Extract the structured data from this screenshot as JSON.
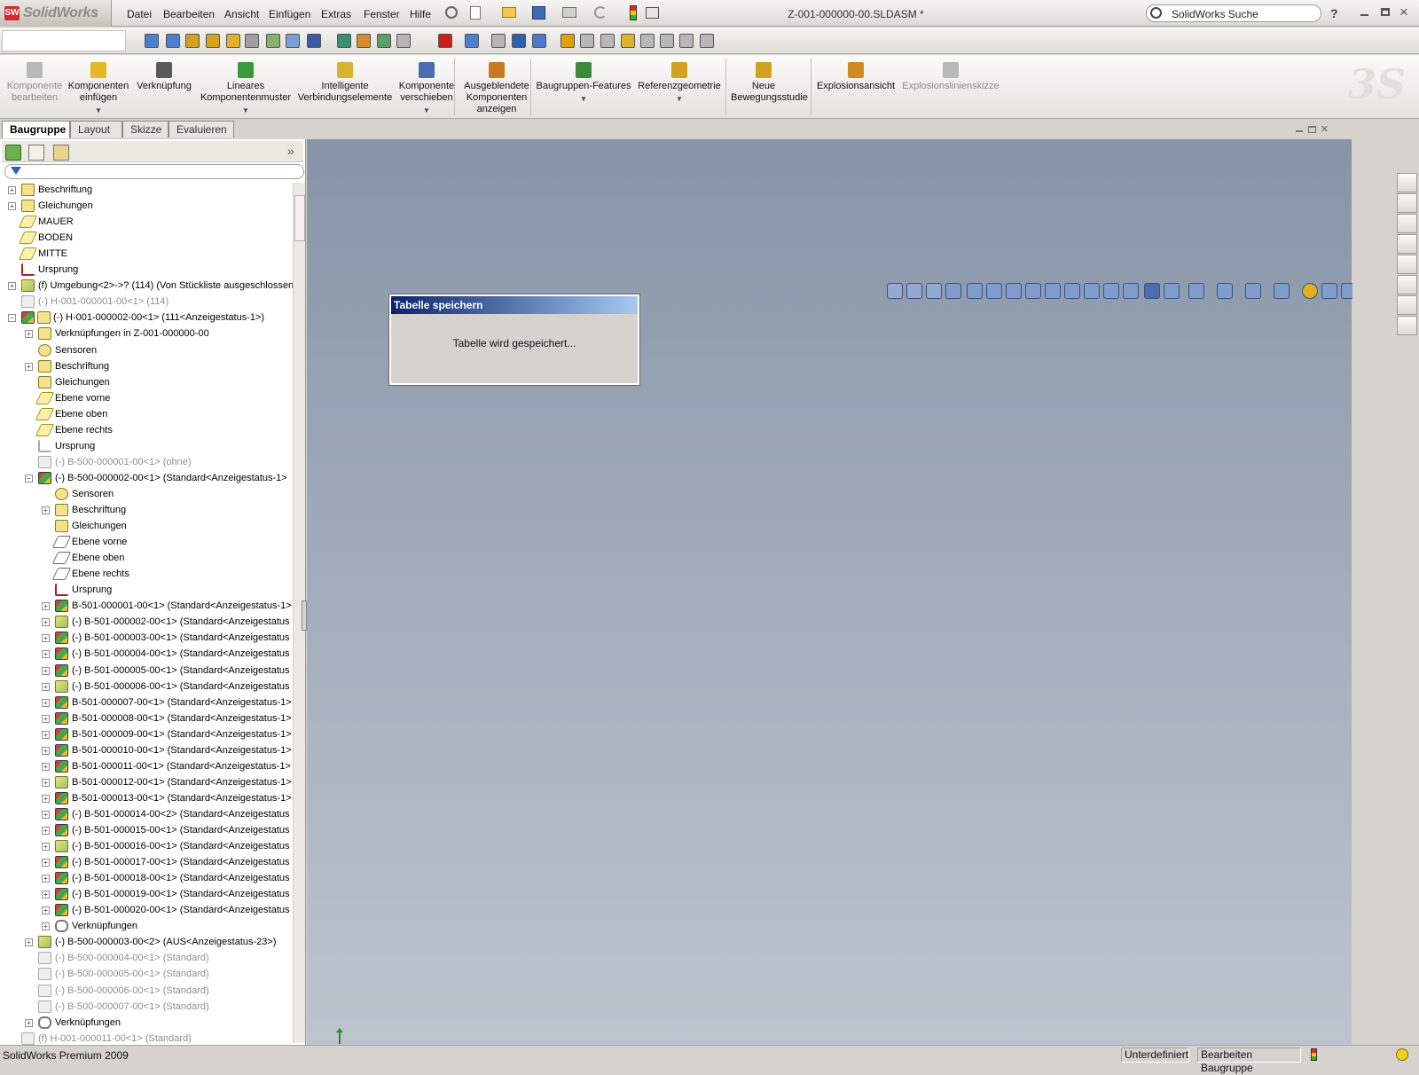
{
  "app": {
    "name": "SolidWorks",
    "logo": "SW",
    "document_title": "Z-001-000000-00.SLDASM *"
  },
  "menu": [
    "Datei",
    "Bearbeiten",
    "Ansicht",
    "Einfügen",
    "Extras",
    "Fenster",
    "Hilfe"
  ],
  "search": {
    "label": "SolidWorks Suche",
    "help": "?"
  },
  "command_manager": [
    {
      "label": "Komponente\nbearbeiten",
      "disabled": true,
      "icon": "edit-component-icon"
    },
    {
      "label": "Komponenten\neinfügen",
      "disabled": false,
      "icon": "insert-components-icon",
      "dropdown": true
    },
    {
      "label": "Verknüpfung",
      "disabled": false,
      "icon": "mate-icon"
    },
    {
      "label": "Lineares\nKomponentenmuster",
      "disabled": false,
      "icon": "linear-pattern-icon",
      "dropdown": true
    },
    {
      "label": "Intelligente\nVerbindungselemente",
      "disabled": false,
      "icon": "smart-fasteners-icon"
    },
    {
      "label": "Komponente\nverschieben",
      "disabled": false,
      "icon": "move-component-icon",
      "dropdown": true
    },
    {
      "label": "Ausgeblendete\nKomponenten\nanzeigen",
      "disabled": false,
      "icon": "show-hidden-icon"
    },
    {
      "label": "Baugruppen-Features",
      "disabled": false,
      "icon": "assembly-features-icon",
      "dropdown": true
    },
    {
      "label": "Referenzgeometrie",
      "disabled": false,
      "icon": "reference-geometry-icon",
      "dropdown": true
    },
    {
      "label": "Neue\nBewegungsstudie",
      "disabled": false,
      "icon": "motion-study-icon"
    },
    {
      "label": "Explosionsansicht",
      "disabled": false,
      "icon": "exploded-view-icon"
    },
    {
      "label": "Explosionslinienskizze",
      "disabled": true,
      "icon": "explode-line-sketch-icon"
    }
  ],
  "tabs": [
    "Baugruppe",
    "Layout",
    "Skizze",
    "Evaluieren"
  ],
  "tree": [
    {
      "label": "Beschriftung",
      "indent": 0,
      "exp": "+",
      "icon": "annotation",
      "dim": false
    },
    {
      "label": "Gleichungen",
      "indent": 0,
      "exp": "+",
      "icon": "equation",
      "dim": false
    },
    {
      "label": "MAUER",
      "indent": 0,
      "exp": "",
      "icon": "plane",
      "dim": false
    },
    {
      "label": "BODEN",
      "indent": 0,
      "exp": "",
      "icon": "plane",
      "dim": false
    },
    {
      "label": "MITTE",
      "indent": 0,
      "exp": "",
      "icon": "plane",
      "dim": false
    },
    {
      "label": "Ursprung",
      "indent": 0,
      "exp": "",
      "icon": "origin",
      "dim": false
    },
    {
      "label": "(f) Umgebung<2>->? (114) (Von Stückliste ausgeschlossen",
      "indent": 0,
      "exp": "+",
      "icon": "part",
      "dim": false
    },
    {
      "label": "(-) H-001-000001-00<1> (114)",
      "indent": 0,
      "exp": "",
      "icon": "suppressed",
      "dim": true
    },
    {
      "label": "(-) H-001-000002-00<1> (111<Anzeigestatus-1>)",
      "indent": 0,
      "exp": "-",
      "icon": "assembly",
      "dim": false
    },
    {
      "label": "Verknüpfungen in Z-001-000000-00",
      "indent": 1,
      "exp": "+",
      "icon": "mates",
      "dim": false
    },
    {
      "label": "Sensoren",
      "indent": 1,
      "exp": "",
      "icon": "sensor",
      "dim": false
    },
    {
      "label": "Beschriftung",
      "indent": 1,
      "exp": "+",
      "icon": "annotation",
      "dim": false
    },
    {
      "label": "Gleichungen",
      "indent": 1,
      "exp": "",
      "icon": "equation",
      "dim": false
    },
    {
      "label": "Ebene vorne",
      "indent": 1,
      "exp": "",
      "icon": "plane",
      "dim": false
    },
    {
      "label": "Ebene oben",
      "indent": 1,
      "exp": "",
      "icon": "plane",
      "dim": false
    },
    {
      "label": "Ebene rechts",
      "indent": 1,
      "exp": "",
      "icon": "plane",
      "dim": false
    },
    {
      "label": "Ursprung",
      "indent": 1,
      "exp": "",
      "icon": "origin-dim",
      "dim": false
    },
    {
      "label": "(-) B-500-000001-00<1> (ohne)",
      "indent": 1,
      "exp": "",
      "icon": "suppressed",
      "dim": true
    },
    {
      "label": "(-) B-500-000002-00<1> (Standard<Anzeigestatus-1>",
      "indent": 1,
      "exp": "-",
      "icon": "assembly",
      "dim": false
    },
    {
      "label": "Sensoren",
      "indent": 2,
      "exp": "",
      "icon": "sensor",
      "dim": false
    },
    {
      "label": "Beschriftung",
      "indent": 2,
      "exp": "+",
      "icon": "annotation",
      "dim": false
    },
    {
      "label": "Gleichungen",
      "indent": 2,
      "exp": "",
      "icon": "equation",
      "dim": false
    },
    {
      "label": "Ebene vorne",
      "indent": 2,
      "exp": "",
      "icon": "plane-out",
      "dim": false
    },
    {
      "label": "Ebene oben",
      "indent": 2,
      "exp": "",
      "icon": "plane-out",
      "dim": false
    },
    {
      "label": "Ebene rechts",
      "indent": 2,
      "exp": "",
      "icon": "plane-out",
      "dim": false
    },
    {
      "label": "Ursprung",
      "indent": 2,
      "exp": "",
      "icon": "origin",
      "dim": false
    },
    {
      "label": "B-501-000001-00<1> (Standard<Anzeigestatus-1>",
      "indent": 2,
      "exp": "+",
      "icon": "assembly",
      "dim": false
    },
    {
      "label": "(-) B-501-000002-00<1> (Standard<Anzeigestatus",
      "indent": 2,
      "exp": "+",
      "icon": "part",
      "dim": false
    },
    {
      "label": "(-) B-501-000003-00<1> (Standard<Anzeigestatus",
      "indent": 2,
      "exp": "+",
      "icon": "assembly",
      "dim": false
    },
    {
      "label": "(-) B-501-000004-00<1> (Standard<Anzeigestatus",
      "indent": 2,
      "exp": "+",
      "icon": "assembly",
      "dim": false
    },
    {
      "label": "(-) B-501-000005-00<1> (Standard<Anzeigestatus",
      "indent": 2,
      "exp": "+",
      "icon": "assembly",
      "dim": false
    },
    {
      "label": "(-) B-501-000006-00<1> (Standard<Anzeigestatus",
      "indent": 2,
      "exp": "+",
      "icon": "part",
      "dim": false
    },
    {
      "label": "B-501-000007-00<1> (Standard<Anzeigestatus-1>",
      "indent": 2,
      "exp": "+",
      "icon": "assembly",
      "dim": false
    },
    {
      "label": "B-501-000008-00<1> (Standard<Anzeigestatus-1>",
      "indent": 2,
      "exp": "+",
      "icon": "assembly",
      "dim": false
    },
    {
      "label": "B-501-000009-00<1> (Standard<Anzeigestatus-1>",
      "indent": 2,
      "exp": "+",
      "icon": "assembly",
      "dim": false
    },
    {
      "label": "B-501-000010-00<1> (Standard<Anzeigestatus-1>",
      "indent": 2,
      "exp": "+",
      "icon": "assembly",
      "dim": false
    },
    {
      "label": "B-501-000011-00<1> (Standard<Anzeigestatus-1>",
      "indent": 2,
      "exp": "+",
      "icon": "assembly",
      "dim": false
    },
    {
      "label": "B-501-000012-00<1> (Standard<Anzeigestatus-1>",
      "indent": 2,
      "exp": "+",
      "icon": "part",
      "dim": false
    },
    {
      "label": "B-501-000013-00<1> (Standard<Anzeigestatus-1>",
      "indent": 2,
      "exp": "+",
      "icon": "assembly",
      "dim": false
    },
    {
      "label": "(-) B-501-000014-00<2> (Standard<Anzeigestatus",
      "indent": 2,
      "exp": "+",
      "icon": "assembly",
      "dim": false
    },
    {
      "label": "(-) B-501-000015-00<1> (Standard<Anzeigestatus",
      "indent": 2,
      "exp": "+",
      "icon": "assembly",
      "dim": false
    },
    {
      "label": "(-) B-501-000016-00<1> (Standard<Anzeigestatus",
      "indent": 2,
      "exp": "+",
      "icon": "part",
      "dim": false
    },
    {
      "label": "(-) B-501-000017-00<1> (Standard<Anzeigestatus",
      "indent": 2,
      "exp": "+",
      "icon": "assembly",
      "dim": false
    },
    {
      "label": "(-) B-501-000018-00<1> (Standard<Anzeigestatus",
      "indent": 2,
      "exp": "+",
      "icon": "assembly",
      "dim": false
    },
    {
      "label": "(-) B-501-000019-00<1> (Standard<Anzeigestatus",
      "indent": 2,
      "exp": "+",
      "icon": "assembly",
      "dim": false
    },
    {
      "label": "(-) B-501-000020-00<1> (Standard<Anzeigestatus",
      "indent": 2,
      "exp": "+",
      "icon": "assembly",
      "dim": false
    },
    {
      "label": "Verknüpfungen",
      "indent": 2,
      "exp": "+",
      "icon": "mates-clip",
      "dim": false
    },
    {
      "label": "(-) B-500-000003-00<2> (AUS<Anzeigestatus-23>)",
      "indent": 1,
      "exp": "+",
      "icon": "part",
      "dim": false
    },
    {
      "label": "(-) B-500-000004-00<1> (Standard)",
      "indent": 1,
      "exp": "",
      "icon": "suppressed",
      "dim": true
    },
    {
      "label": "(-) B-500-000005-00<1> (Standard)",
      "indent": 1,
      "exp": "",
      "icon": "suppressed",
      "dim": true
    },
    {
      "label": "(-) B-500-000006-00<1> (Standard)",
      "indent": 1,
      "exp": "",
      "icon": "suppressed",
      "dim": true
    },
    {
      "label": "(-) B-500-000007-00<1> (Standard)",
      "indent": 1,
      "exp": "",
      "icon": "suppressed",
      "dim": true
    },
    {
      "label": "Verknüpfungen",
      "indent": 1,
      "exp": "+",
      "icon": "mates-clip",
      "dim": false
    },
    {
      "label": "(f) H-001-000011-00<1> (Standard)",
      "indent": 0,
      "exp": "",
      "icon": "suppressed",
      "dim": true
    }
  ],
  "dialog": {
    "title": "Tabelle speichern",
    "message": "Tabelle wird gespeichert..."
  },
  "status": {
    "left": "SolidWorks Premium 2009",
    "state": "Unterdefiniert",
    "mode": "Bearbeiten Baugruppe"
  },
  "colors": {
    "viewport_top": "#8794a8",
    "viewport_bottom": "#bec4ce",
    "dialog_caption": "#0a246a",
    "accent_red": "#d32b2b"
  }
}
